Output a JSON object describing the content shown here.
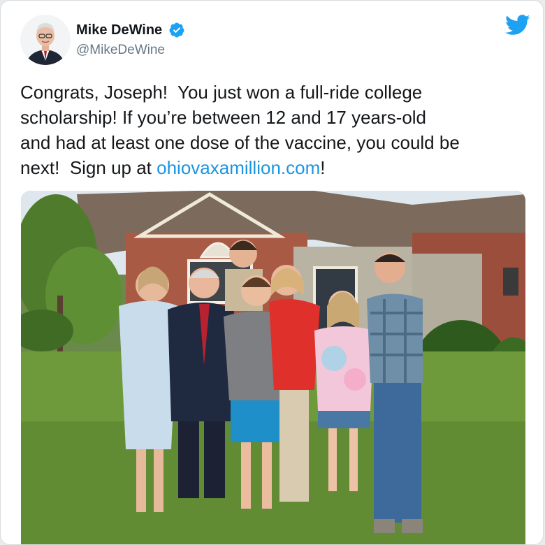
{
  "author": {
    "display_name": "Mike DeWine",
    "handle": "@MikeDeWine",
    "verified": true
  },
  "brand": {
    "logo": "twitter-bird-icon",
    "color": "#1da1f2"
  },
  "tweet": {
    "text_before_link": "Congrats, Joseph!  You just won a full-ride college\nscholarship! If you’re between 12 and 17 years-old\nand had at least one dose of the vaccine, you could be\nnext!  Sign up at ",
    "link_text": "ohiovaxamillion.com",
    "text_after_link": "!",
    "link_color": "#1b95e0"
  },
  "media": {
    "type": "photo"
  }
}
